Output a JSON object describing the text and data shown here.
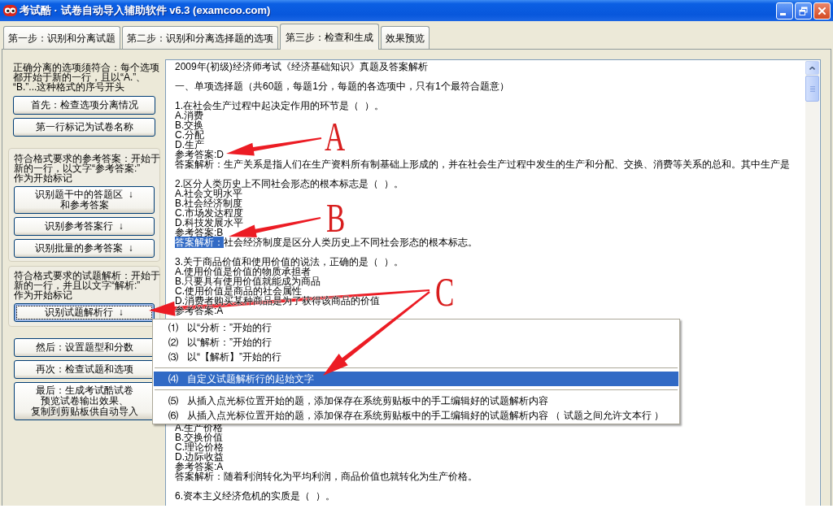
{
  "window": {
    "title": "考试酷 · 试卷自动导入辅助软件 v6.3 (examcoo.com)"
  },
  "tabs": [
    {
      "label": "第一步：识别和分离试题",
      "selected": false
    },
    {
      "label": "第二步：识别和分离选择题的选项",
      "selected": false
    },
    {
      "label": "第三步：检查和生成",
      "selected": true
    },
    {
      "label": "效果预览",
      "selected": false
    }
  ],
  "left_panel": {
    "groups": [
      {
        "framed": false,
        "note": [
          "正确分离的选项须符合：每个选项",
          "都开始于新的一行，且以“A.”、",
          "“B.”...这种格式的序号开头"
        ],
        "buttons": [
          {
            "lines": [
              "首先：检查选项分离情况"
            ],
            "focused": false
          },
          {
            "lines": [
              "第一行标记为试卷名称"
            ],
            "focused": false
          }
        ]
      },
      {
        "framed": true,
        "note": [
          "符合格式要求的参考答案：开始于",
          "新的一行，以文字“参考答案:”",
          "作为开始标记"
        ],
        "buttons": [
          {
            "lines": [
              "识别题干中的答题区  ↓",
              "和参考答案"
            ],
            "focused": false
          },
          {
            "lines": [
              "识别参考答案行  ↓"
            ],
            "focused": false
          },
          {
            "lines": [
              "识别批量的参考答案  ↓"
            ],
            "focused": false
          }
        ]
      },
      {
        "framed": true,
        "note": [
          "符合格式要求的试题解析：开始于",
          "新的一行，并且以文字“解析:”",
          "作为开始标记"
        ],
        "buttons": [
          {
            "lines": [
              "识别试题解析行  ↓"
            ],
            "focused": true
          }
        ]
      }
    ],
    "buttons": [
      {
        "lines": [
          "然后：设置题型和分数"
        ],
        "focused": false
      },
      {
        "lines": [
          "再次：检查试题和选项"
        ],
        "focused": false
      },
      {
        "lines": [
          "最后：生成考试酷试卷",
          "预览试卷输出效果、",
          "复制到剪贴板供自动导入"
        ],
        "focused": false
      }
    ]
  },
  "editor": {
    "blocks_above_menu": [
      [
        {
          "text": "2009年(初级)经济师考试《经济基础知识》真题及答案解析"
        }
      ],
      [
        {
          "text": "一、单项选择题（共60题，每题1分，每题的各选项中，只有1个最符合题意）"
        }
      ],
      [
        {
          "text": "1.在社会生产过程中起决定作用的环节是（  ）。"
        },
        {
          "text": "A.消费"
        },
        {
          "text": "B.交换"
        },
        {
          "text": "C.分配"
        },
        {
          "text": "D.生产"
        },
        {
          "text": "参考答案:D"
        },
        {
          "text": "答案解析：生产关系是指人们在生产资料所有制基础上形成的，并在社会生产过程中发生的生产和分配、交换、消费等关系的总和。其中生产是"
        }
      ],
      [
        {
          "text": "2.区分人类历史上不同社会形态的根本标志是（  ）。"
        },
        {
          "text": "A.社会文明水平"
        },
        {
          "text": "B.社会经济制度"
        },
        {
          "text": "C.市场发达程度"
        },
        {
          "text": "D.科技发展水平"
        },
        {
          "text": "参考答案:B"
        },
        {
          "selected_text": "答案解析：",
          "text": "社会经济制度是区分人类历史上不同社会形态的根本标志。"
        }
      ],
      [
        {
          "text": "3.关于商品价值和使用价值的说法，正确的是（  ）。"
        },
        {
          "text": "A.使用价值是价值的物质承担者"
        },
        {
          "text": "B.只要具有使用价值就能成为商品"
        },
        {
          "text": "C.使用价值是商品的社会属性"
        },
        {
          "text": "D.消费者购买某种商品是为了获得该商品的价值"
        },
        {
          "text": "参考答案:A"
        }
      ]
    ],
    "blocks_below_menu": [
      [
        {
          "text": "A.生产价格"
        },
        {
          "text": "B.交换价值"
        },
        {
          "text": "C.理论价格"
        },
        {
          "text": "D.边际收益"
        },
        {
          "text": "参考答案:A"
        },
        {
          "text": "答案解析：随着利润转化为平均利润，商品价值也就转化为生产价格。"
        }
      ],
      [
        {
          "text": "6.资本主义经济危机的实质是（  ）。"
        }
      ]
    ]
  },
  "context_menu": {
    "sections": [
      [
        {
          "number": "⑴",
          "label": "以“分析：”开始的行",
          "selected": false
        },
        {
          "number": "⑵",
          "label": "以“解析：”开始的行",
          "selected": false
        },
        {
          "number": "⑶",
          "label": "以“【解析】”开始的行",
          "selected": false
        }
      ],
      [
        {
          "number": "⑷",
          "label": "自定义试题解析行的起始文字",
          "selected": true
        }
      ],
      [
        {
          "number": "⑸",
          "label": "从插入点光标位置开始的题，添加保存在系统剪贴板中的手工编辑好的试题解析内容",
          "selected": false
        },
        {
          "number": "⑹",
          "label": "从插入点光标位置开始的题，添加保存在系统剪贴板中的手工编辑好的试题解析内容 （ 试题之间允许文本行 ）",
          "selected": false
        }
      ]
    ]
  },
  "annotations": [
    {
      "letter": "A"
    },
    {
      "letter": "B"
    },
    {
      "letter": "C"
    }
  ]
}
